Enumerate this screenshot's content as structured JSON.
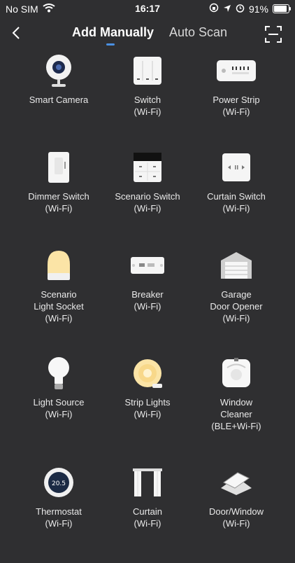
{
  "status_bar": {
    "carrier": "No SIM",
    "time": "16:17",
    "battery_percent": "91%",
    "battery_level": 0.91
  },
  "nav": {
    "tabs": [
      {
        "label": "Add Manually",
        "active": true
      },
      {
        "label": "Auto Scan",
        "active": false
      }
    ]
  },
  "devices": [
    {
      "name": "Smart Camera",
      "icon": "camera-icon"
    },
    {
      "name": "Switch\n(Wi-Fi)",
      "icon": "switch-icon"
    },
    {
      "name": "Power Strip\n(Wi-Fi)",
      "icon": "power-strip-icon"
    },
    {
      "name": "Dimmer Switch\n(Wi-Fi)",
      "icon": "dimmer-switch-icon"
    },
    {
      "name": "Scenario Switch\n(Wi-Fi)",
      "icon": "scenario-switch-icon"
    },
    {
      "name": "Curtain Switch\n(Wi-Fi)",
      "icon": "curtain-switch-icon"
    },
    {
      "name": "Scenario\nLight Socket\n(Wi-Fi)",
      "icon": "light-socket-icon"
    },
    {
      "name": "Breaker\n(Wi-Fi)",
      "icon": "breaker-icon"
    },
    {
      "name": "Garage\nDoor Opener\n(Wi-Fi)",
      "icon": "garage-door-icon"
    },
    {
      "name": "Light Source\n(Wi-Fi)",
      "icon": "light-bulb-icon"
    },
    {
      "name": "Strip Lights\n(Wi-Fi)",
      "icon": "strip-lights-icon"
    },
    {
      "name": "Window\nCleaner\n(BLE+Wi-Fi)",
      "icon": "window-cleaner-icon"
    },
    {
      "name": "Thermostat\n(Wi-Fi)",
      "icon": "thermostat-icon",
      "display": "20.5"
    },
    {
      "name": "Curtain\n(Wi-Fi)",
      "icon": "curtain-icon"
    },
    {
      "name": "Door/Window\n(Wi-Fi)",
      "icon": "door-window-sensor-icon"
    }
  ]
}
